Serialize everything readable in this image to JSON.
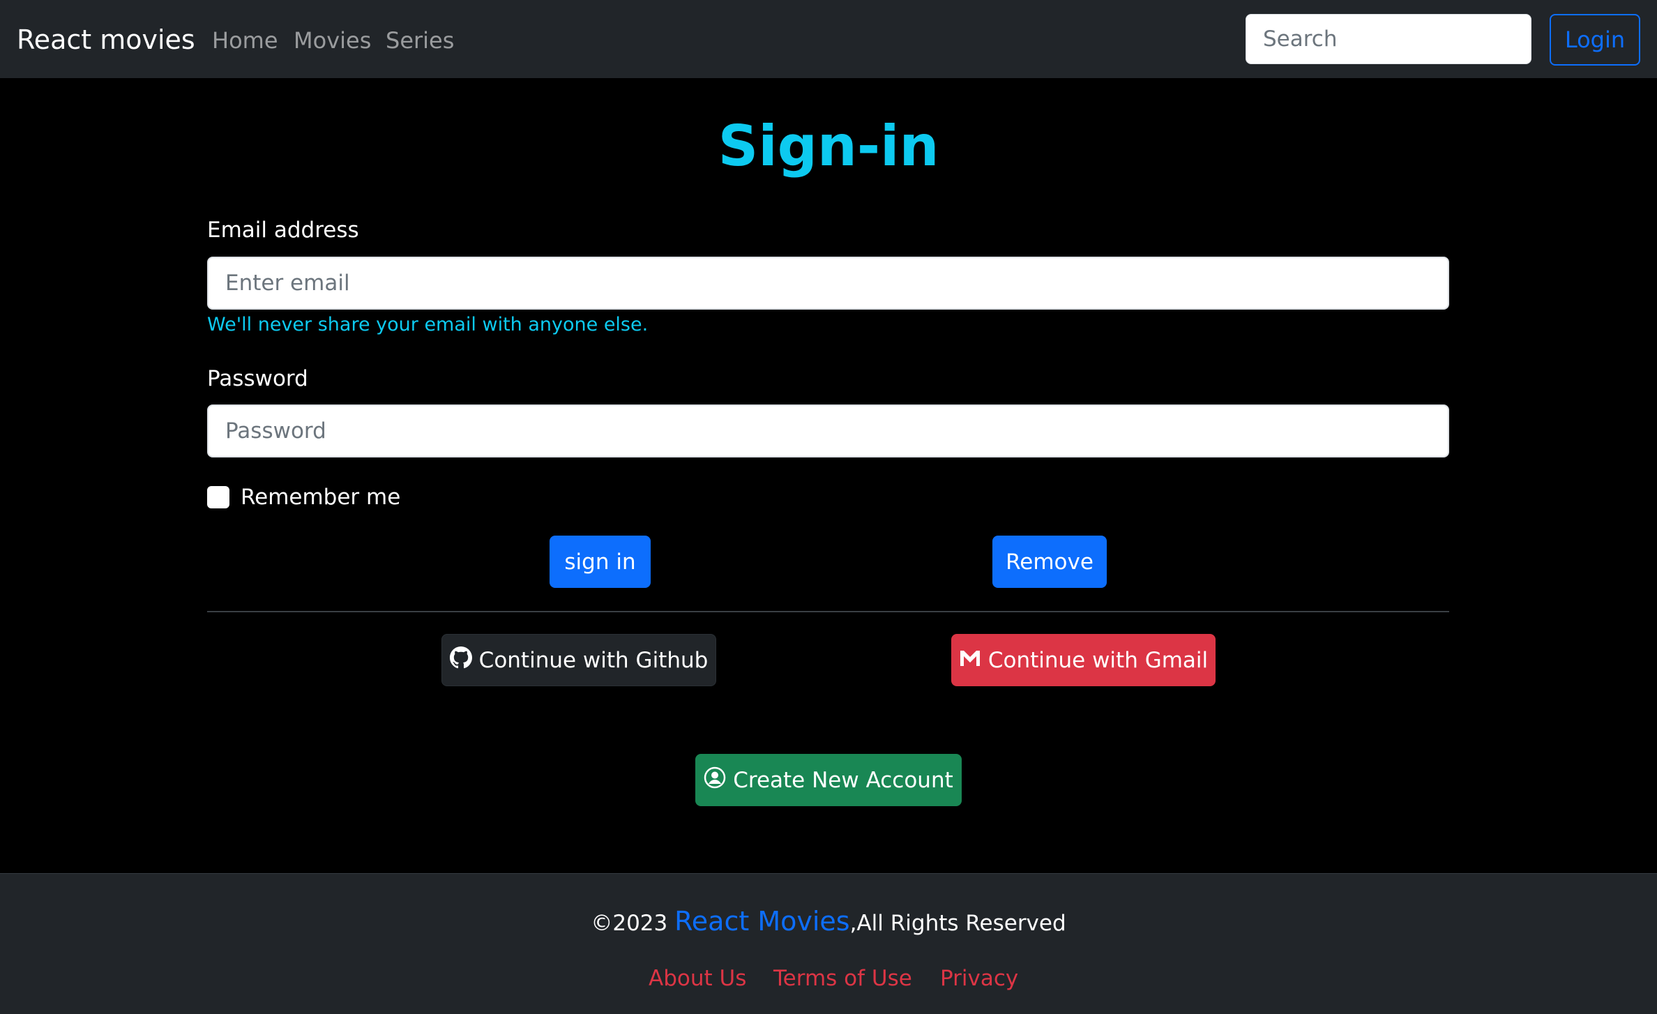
{
  "navbar": {
    "brand": "React movies",
    "links": [
      "Home",
      "Movies",
      "Series"
    ],
    "search_placeholder": "Search",
    "login_label": "Login"
  },
  "main": {
    "title": "Sign-in",
    "email_label": "Email address",
    "email_placeholder": "Enter email",
    "email_help": "We'll never share your email with anyone else.",
    "password_label": "Password",
    "password_placeholder": "Password",
    "remember_label": "Remember me",
    "signin_label": "sign in",
    "remove_label": "Remove",
    "github_label": "Continue with Github",
    "gmail_label": "Continue with Gmail",
    "create_account_label": "Create New Account"
  },
  "footer": {
    "copyright_prefix": "©2023 ",
    "brand": "React Movies",
    "copyright_suffix": ",All Rights Reserved",
    "links": [
      "About Us",
      "Terms of Use",
      "Privacy"
    ]
  },
  "colors": {
    "navbar_bg": "#212529",
    "page_bg": "#000000",
    "accent_cyan": "#0dcaf0",
    "primary": "#0d6efd",
    "danger": "#dc3545",
    "success": "#198754"
  },
  "icons": [
    "github-icon",
    "gmail-icon",
    "user-circle-icon"
  ]
}
